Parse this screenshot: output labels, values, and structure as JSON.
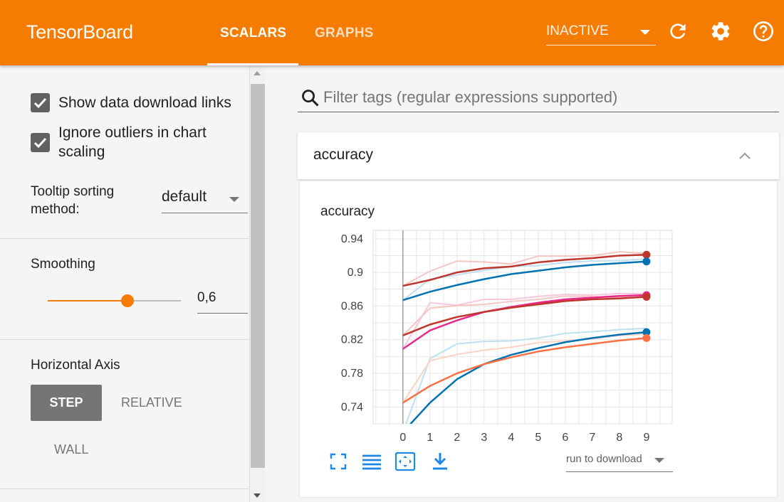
{
  "app": {
    "title": "TensorBoard",
    "tabs": [
      {
        "label": "SCALARS",
        "active": true
      },
      {
        "label": "GRAPHS",
        "active": false
      }
    ],
    "run_status": "INACTIVE",
    "icons": [
      "refresh-icon",
      "settings-icon",
      "help-icon"
    ],
    "accent": "#f57c00"
  },
  "sidebar": {
    "show_download_links": {
      "label": "Show data download links",
      "checked": true
    },
    "ignore_outliers": {
      "label_line1": "Ignore outliers in chart",
      "label_line2": "scaling",
      "checked": true
    },
    "tooltip_sorting": {
      "label_line1": "Tooltip sorting",
      "label_line2": "method:",
      "value": "default"
    },
    "smoothing": {
      "label": "Smoothing",
      "value": 0.6,
      "display": "0,6"
    },
    "horizontal_axis": {
      "label": "Horizontal Axis",
      "options": [
        "STEP",
        "RELATIVE",
        "WALL"
      ],
      "selected": "STEP"
    }
  },
  "main": {
    "filter_placeholder": "Filter tags (regular expressions supported)",
    "card_title": "accuracy",
    "chart_title": "accuracy",
    "download_select": "run to download"
  },
  "chart_data": {
    "type": "line",
    "title": "accuracy",
    "xlabel": "",
    "ylabel": "",
    "x": [
      0,
      1,
      2,
      3,
      4,
      5,
      6,
      7,
      8,
      9
    ],
    "ylim": [
      0.72,
      0.95
    ],
    "yticks": [
      0.74,
      0.78,
      0.82,
      0.86,
      0.9,
      0.94
    ],
    "grid": true,
    "series": [
      {
        "color": "#c0362c",
        "raw_color": "#f4c7c3",
        "values": [
          0.884,
          0.891,
          0.9,
          0.905,
          0.907,
          0.912,
          0.915,
          0.917,
          0.92,
          0.921
        ]
      },
      {
        "color": "#0072b2",
        "raw_color": "#bfe0f0",
        "values": [
          0.867,
          0.877,
          0.885,
          0.892,
          0.898,
          0.902,
          0.906,
          0.909,
          0.911,
          0.913
        ]
      },
      {
        "color": "#e7298a",
        "raw_color": "#f7c7de",
        "values": [
          0.809,
          0.831,
          0.843,
          0.853,
          0.859,
          0.864,
          0.868,
          0.87,
          0.872,
          0.873
        ]
      },
      {
        "color": "#c0362c",
        "raw_color": "#f4c7c3",
        "values": [
          0.825,
          0.838,
          0.847,
          0.853,
          0.858,
          0.862,
          0.866,
          0.868,
          0.869,
          0.871
        ]
      },
      {
        "color": "#0072b2",
        "raw_color": "#bfe0f0",
        "values": [
          0.71,
          0.745,
          0.773,
          0.791,
          0.802,
          0.81,
          0.817,
          0.822,
          0.826,
          0.829
        ]
      },
      {
        "color": "#ff7043",
        "raw_color": "#fcd3c3",
        "values": [
          0.745,
          0.765,
          0.78,
          0.791,
          0.799,
          0.806,
          0.811,
          0.815,
          0.819,
          0.822
        ]
      }
    ]
  }
}
